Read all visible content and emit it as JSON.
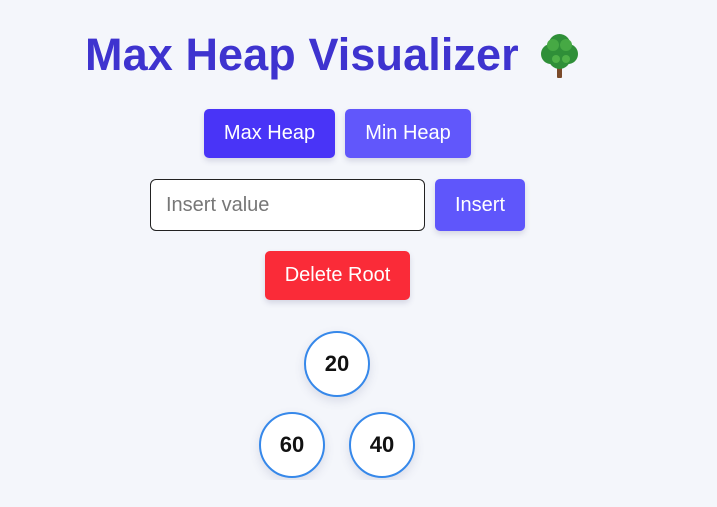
{
  "page": {
    "title": "Max Heap Visualizer",
    "title_icon": "tree-icon",
    "accent_color": "#3e33cf"
  },
  "mode_buttons": {
    "max_label": "Max Heap",
    "min_label": "Min Heap",
    "max_color": "#4934f7",
    "min_color": "#6157fb"
  },
  "insert": {
    "placeholder": "Insert value",
    "value": "",
    "button_label": "Insert",
    "button_color": "#5f56fb"
  },
  "delete": {
    "button_label": "Delete Root",
    "button_color": "#fa2b38"
  },
  "heap": {
    "nodes": [
      {
        "value": "20"
      },
      {
        "value": "60"
      },
      {
        "value": "40"
      }
    ],
    "node_border_color": "#3688ea"
  }
}
